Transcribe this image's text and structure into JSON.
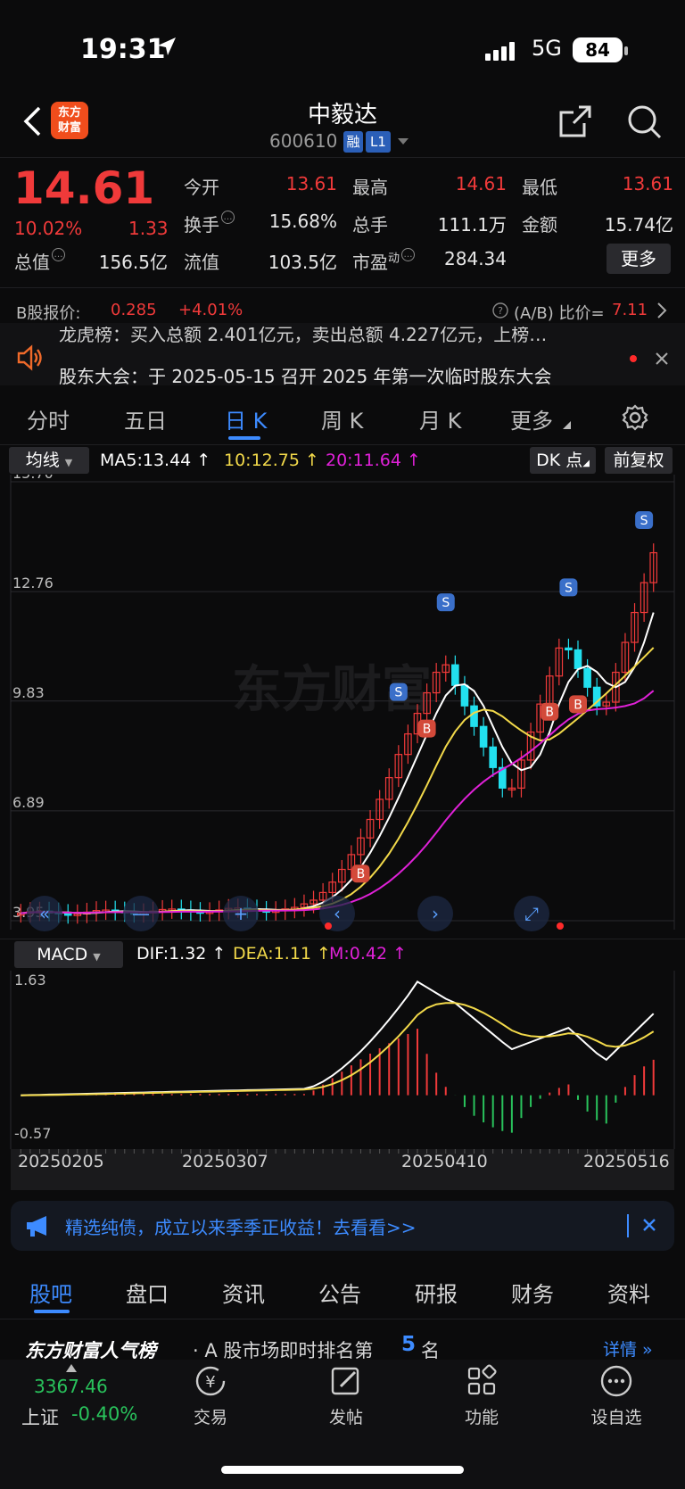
{
  "status": {
    "time": "19:31",
    "network": "5G",
    "battery": "84"
  },
  "header": {
    "logo": "东方\n财富",
    "name": "中毅达",
    "code": "600610",
    "tag1": "融",
    "tag2": "L1"
  },
  "quote": {
    "price": "14.61",
    "pct": "10.02%",
    "change": "1.33",
    "open_label": "今开",
    "open": "13.61",
    "high_label": "最高",
    "high": "14.61",
    "low_label": "最低",
    "low": "13.61",
    "turnover_label": "换手",
    "turnover": "15.68%",
    "volume_label": "总手",
    "volume": "111.1万",
    "amount_label": "金额",
    "amount": "15.74亿",
    "mktcap_label": "总值",
    "mktcap": "156.5亿",
    "float_label": "流值",
    "float": "103.5亿",
    "pe_label": "市盈",
    "pe_sup": "动",
    "pe": "284.34",
    "more": "更多"
  },
  "bshare": {
    "label": "B股报价:",
    "price": "0.285",
    "pct": "+4.01%",
    "ratio_label": "(A/B) 比价=",
    "ratio": "7.11"
  },
  "news": {
    "line1": "龙虎榜：买入总额 2.401亿元，卖出总额 4.227亿元，上榜…",
    "line2": "股东大会：于 2025-05-15 召开 2025 年第一次临时股东大会"
  },
  "tabs": [
    "分时",
    "五日",
    "日 K",
    "周 K",
    "月 K",
    "更多"
  ],
  "active_tab": 2,
  "kline": {
    "indicator": "均线",
    "ma5": "MA5:13.44",
    "ma10": "10:12.75",
    "ma20": "20:11.64",
    "dk": "DK 点",
    "adjust": "前复权",
    "y_labels": [
      "15.70",
      "12.76",
      "9.83",
      "6.89",
      "3.95"
    ],
    "watermark": "东方财富",
    "buy_mark": "B",
    "sell_mark": "S"
  },
  "macd": {
    "indicator": "MACD",
    "dif": "DIF:1.32",
    "dea": "DEA:1.11",
    "m": "M:0.42",
    "y_top": "1.63",
    "y_bottom": "-0.57",
    "dates": [
      "20250205",
      "20250307",
      "20250410",
      "20250516"
    ]
  },
  "banner": {
    "text": "精选纯债，成立以来季季正收益！去看看>>"
  },
  "bottom_tabs": [
    "股吧",
    "盘口",
    "资讯",
    "公告",
    "研报",
    "财务",
    "资料"
  ],
  "rank": {
    "brand": "东方财富人气榜",
    "text": "· A 股市场即时排名第",
    "num": "5",
    "suffix": "名",
    "detail": "详情"
  },
  "nav": {
    "index_value": "3367.46",
    "index_name": "上证",
    "index_pct": "-0.40%",
    "items": [
      "交易",
      "发帖",
      "功能",
      "设自选"
    ]
  },
  "colors": {
    "up": "#f03a3a",
    "down": "#29c35c",
    "accent": "#3d8bff",
    "ma5": "#ffffff",
    "ma10": "#f2d94a",
    "ma20": "#e021d8",
    "cyan": "#22e0ef"
  }
}
